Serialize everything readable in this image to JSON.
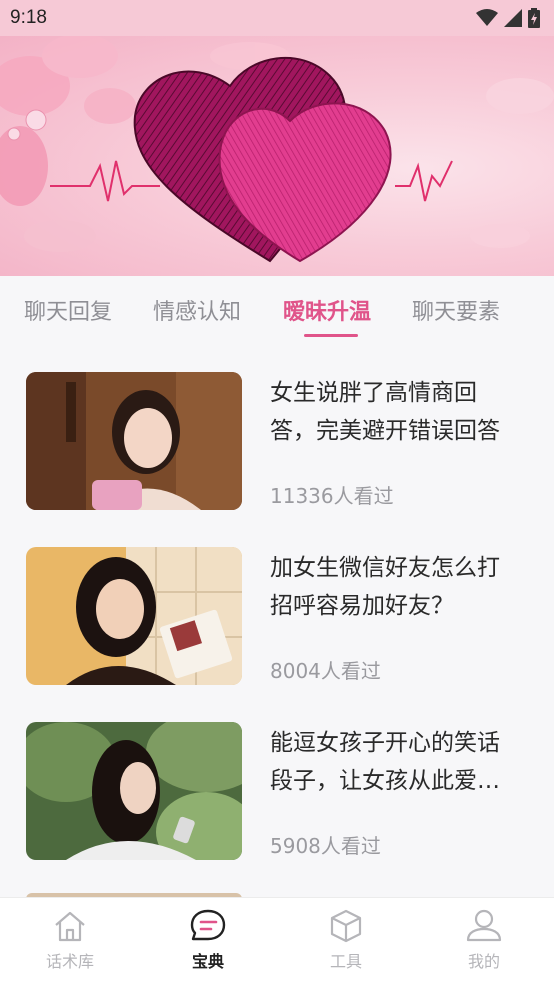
{
  "status_bar": {
    "time": "9:18"
  },
  "tabs": [
    {
      "label": "聊天回复",
      "active": false
    },
    {
      "label": "情感认知",
      "active": false
    },
    {
      "label": "暧昧升温",
      "active": true
    },
    {
      "label": "聊天要素",
      "active": false
    }
  ],
  "articles": [
    {
      "title": "女生说胖了高情商回答，完美避开错误回答",
      "views": "11336人看过"
    },
    {
      "title": "加女生微信好友怎么打招呼容易加好友？",
      "views": "8004人看过"
    },
    {
      "title": "能逗女孩子开心的笑话段子，让女孩从此爱上你",
      "views": "5908人看过"
    }
  ],
  "bottom_nav": [
    {
      "label": "话术库",
      "icon": "home-icon",
      "active": false
    },
    {
      "label": "宝典",
      "icon": "chat-bubble-icon",
      "active": true
    },
    {
      "label": "工具",
      "icon": "cube-icon",
      "active": false
    },
    {
      "label": "我的",
      "icon": "person-icon",
      "active": false
    }
  ],
  "colors": {
    "accent": "#e0548a",
    "status_bar": "#f6c9d6",
    "inactive": "#8f8f95"
  }
}
